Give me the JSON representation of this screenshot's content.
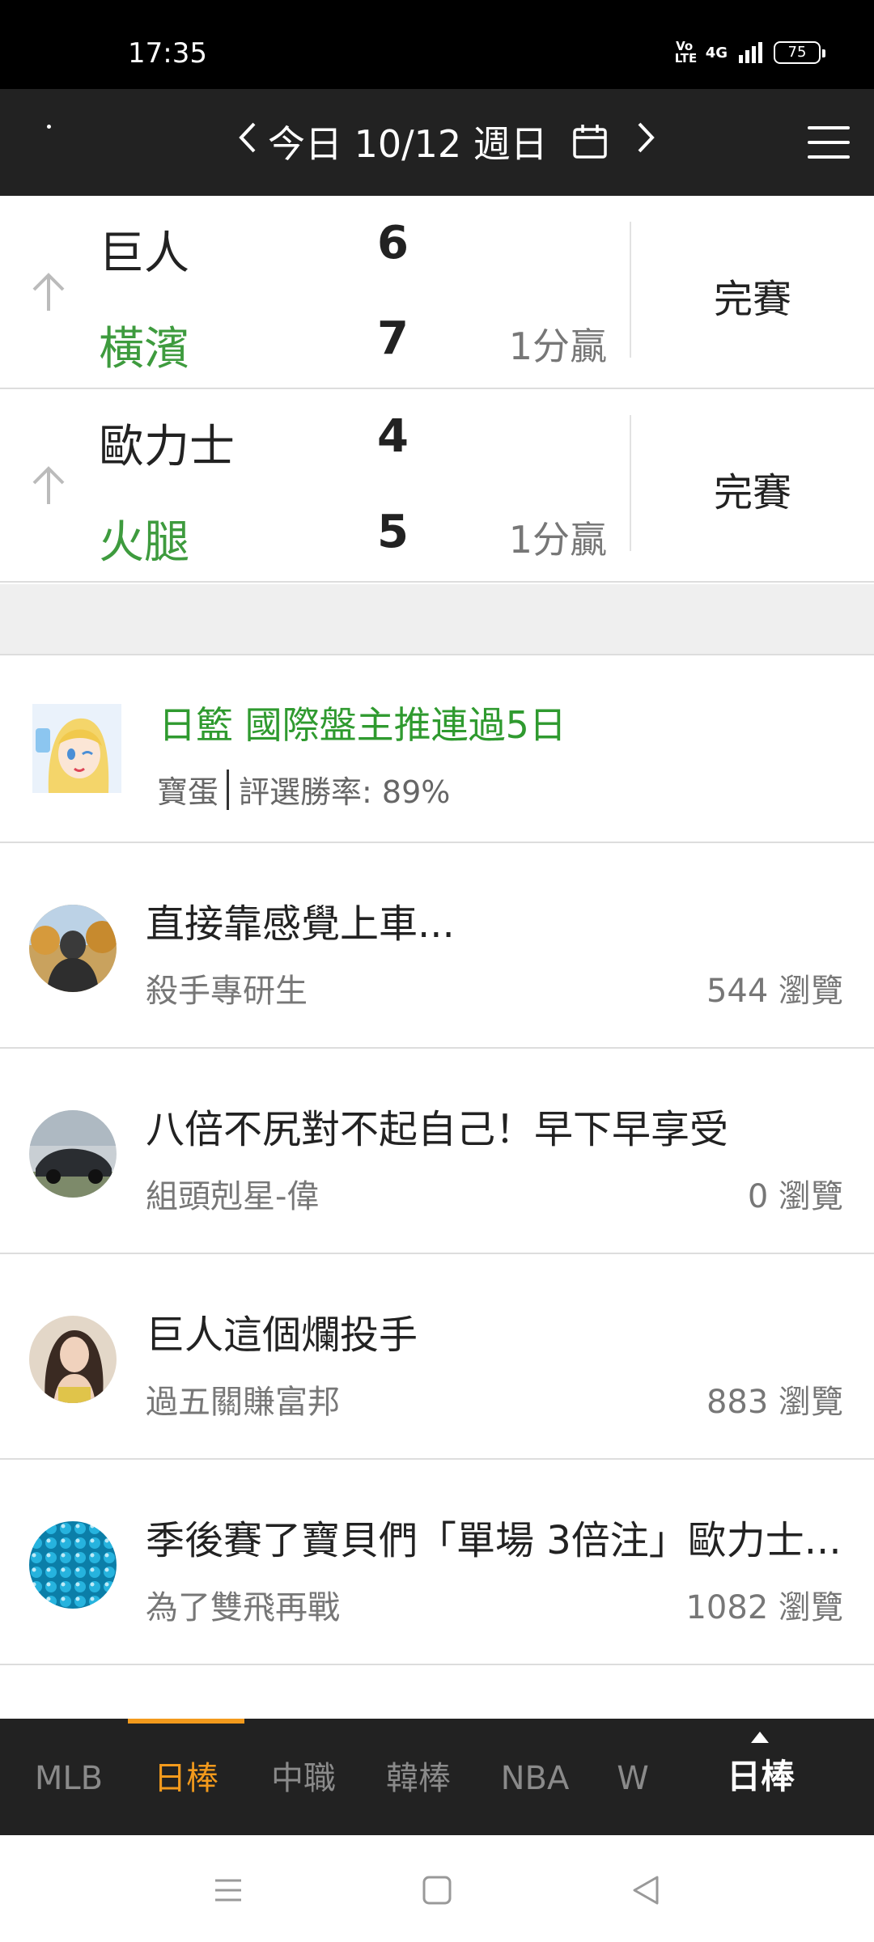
{
  "status_bar": {
    "time": "17:35",
    "volte": "Vo LTE",
    "network": "4G",
    "battery": "75"
  },
  "header": {
    "date_label": "今日 10/12 週日"
  },
  "games": [
    {
      "away_team": "巨人",
      "away_score": "6",
      "home_team": "橫濱",
      "home_score": "7",
      "margin": "1分贏",
      "status": "完賽"
    },
    {
      "away_team": "歐力士",
      "away_score": "4",
      "home_team": "火腿",
      "home_score": "5",
      "margin": "1分贏",
      "status": "完賽"
    }
  ],
  "featured": {
    "title": "日籃 國際盤主推連過5日",
    "author": "寶蛋",
    "win_rate": "評選勝率: 89%"
  },
  "posts": [
    {
      "title": "直接靠感覺上車...",
      "author": "殺手專研生",
      "views": "544 瀏覽"
    },
    {
      "title": "八倍不尻對不起自己！早下早享受",
      "author": "組頭剋星-偉",
      "views": "0 瀏覽"
    },
    {
      "title": "巨人這個爛投手",
      "author": "過五關賺富邦",
      "views": "883 瀏覽"
    },
    {
      "title": "季後賽了寶貝們「單場 3倍注」歐力士...",
      "author": "為了雙飛再戰",
      "views": "1082 瀏覽"
    }
  ],
  "tabs": [
    {
      "label": "MLB",
      "active": false
    },
    {
      "label": "日棒",
      "active": true
    },
    {
      "label": "中職",
      "active": false
    },
    {
      "label": "韓棒",
      "active": false
    },
    {
      "label": "NBA",
      "active": false
    },
    {
      "label": "W",
      "active": false
    }
  ],
  "current_league": "日棒",
  "colors": {
    "home_team": "#3e9b3e",
    "featured_title": "#2f9a2f",
    "active_tab": "#f39a1c",
    "header_bg": "#222222"
  }
}
